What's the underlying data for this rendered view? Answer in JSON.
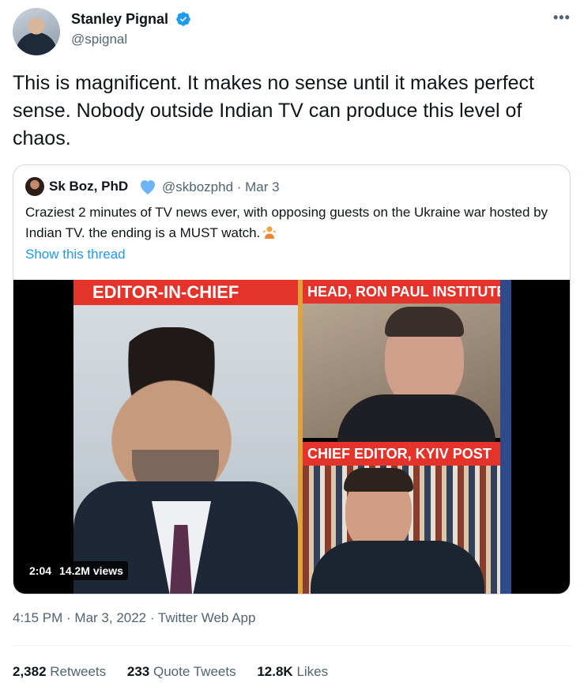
{
  "author": {
    "name": "Stanley Pignal",
    "handle": "@spignal",
    "verified": true
  },
  "menu_icon": "more-horizontal-icon",
  "tweet": {
    "text": "This is magnificent. It makes no sense until it makes perfect sense. Nobody outside Indian TV can produce this level of chaos."
  },
  "quoted": {
    "name": "Sk Boz, PhD",
    "handle_date": "@skbozphd · Mar 3",
    "text": "Craziest 2 minutes of TV news ever, with opposing guests on the Ukraine war hosted by Indian TV. the ending is a MUST watch.",
    "show_thread": "Show this thread",
    "video": {
      "banner_left": "EDITOR-IN-CHIEF",
      "banner_right_top": "HEAD, RON PAUL INSTITUTE",
      "banner_right_bottom": "CHIEF EDITOR, KYIV POST",
      "duration": "2:04",
      "views": "14.2M views"
    }
  },
  "meta": {
    "time_date_source": "4:15 PM · Mar 3, 2022 · Twitter Web App"
  },
  "stats": {
    "retweets_count": "2,382",
    "retweets_label": "Retweets",
    "quotes_count": "233",
    "quotes_label": "Quote Tweets",
    "likes_count": "12.8K",
    "likes_label": "Likes"
  },
  "colors": {
    "link": "#1d9bf0",
    "secondary_text": "#536471",
    "verified_badge": "#1d9bf0",
    "banner_red": "#e3332b"
  }
}
